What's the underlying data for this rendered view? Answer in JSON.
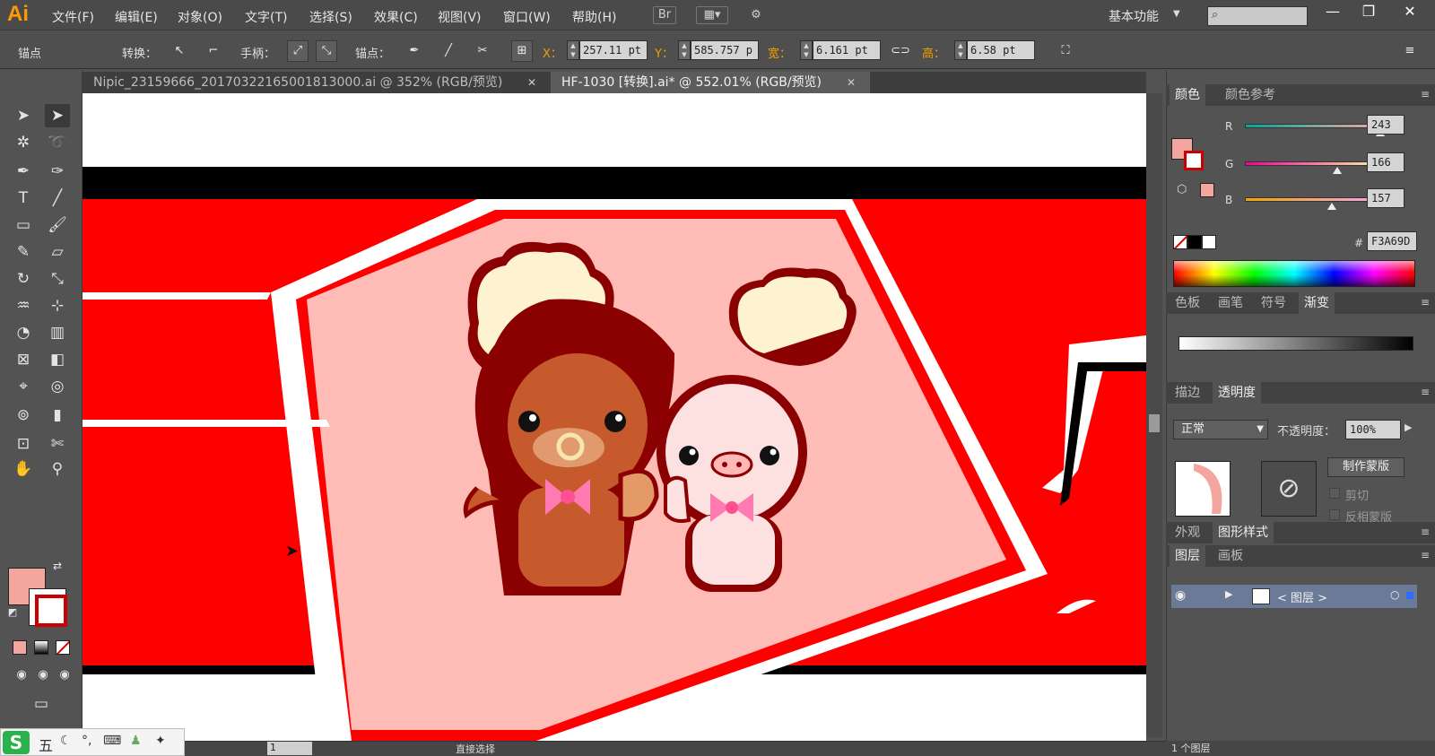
{
  "app": {
    "logo": "Ai",
    "menus": [
      "文件(F)",
      "编辑(E)",
      "对象(O)",
      "文字(T)",
      "选择(S)",
      "效果(C)",
      "视图(V)",
      "窗口(W)",
      "帮助(H)"
    ],
    "workspace": "基本功能",
    "window_buttons": [
      "—",
      "❐",
      "✕"
    ]
  },
  "control_bar": {
    "anchor_label": "锚点",
    "convert_label": "转换：",
    "handle_label": "手柄：",
    "anchors_label": "锚点：",
    "x_label": "X：",
    "x_value": "257.11 pt",
    "y_label": "Y：",
    "y_value": "585.757 p",
    "width_label": "宽：",
    "width_value": "6.161 pt",
    "height_label": "高：",
    "height_value": "6.58 pt"
  },
  "tabs": [
    {
      "label": "Nipic_23159666_20170322165001813000.ai @ 352% (RGB/预览)",
      "active": false
    },
    {
      "label": "HF-1030 [转换].ai* @ 552.01% (RGB/预览)",
      "active": true
    }
  ],
  "color_panel": {
    "tabs": [
      "颜色",
      "颜色参考"
    ],
    "r_label": "R",
    "r_value": "243",
    "r_pos": 0.953,
    "g_label": "G",
    "g_value": "166",
    "g_pos": 0.651,
    "b_label": "B",
    "b_value": "157",
    "b_pos": 0.616,
    "hex_label": "#",
    "hex_value": "F3A69D",
    "fill_color": "#f3a69d"
  },
  "swatch_panel": {
    "tabs": [
      "色板",
      "画笔",
      "符号",
      "渐变"
    ]
  },
  "transparency_panel": {
    "tabs": [
      "描边",
      "透明度"
    ],
    "blend_mode": "正常",
    "opacity_label": "不透明度：",
    "opacity_value": "100%",
    "make_mask": "制作蒙版",
    "clip": "剪切",
    "invert_mask": "反相蒙版"
  },
  "appearance_panel": {
    "tabs": [
      "外观",
      "图形样式"
    ]
  },
  "layers_panel": {
    "tabs": [
      "图层",
      "画板"
    ],
    "layer_name": "< 图层 >",
    "layer_count": "1 个图层"
  },
  "status": {
    "zoom_page": "1",
    "tool_name": "直接选择"
  },
  "ime": {
    "mode": "五"
  }
}
